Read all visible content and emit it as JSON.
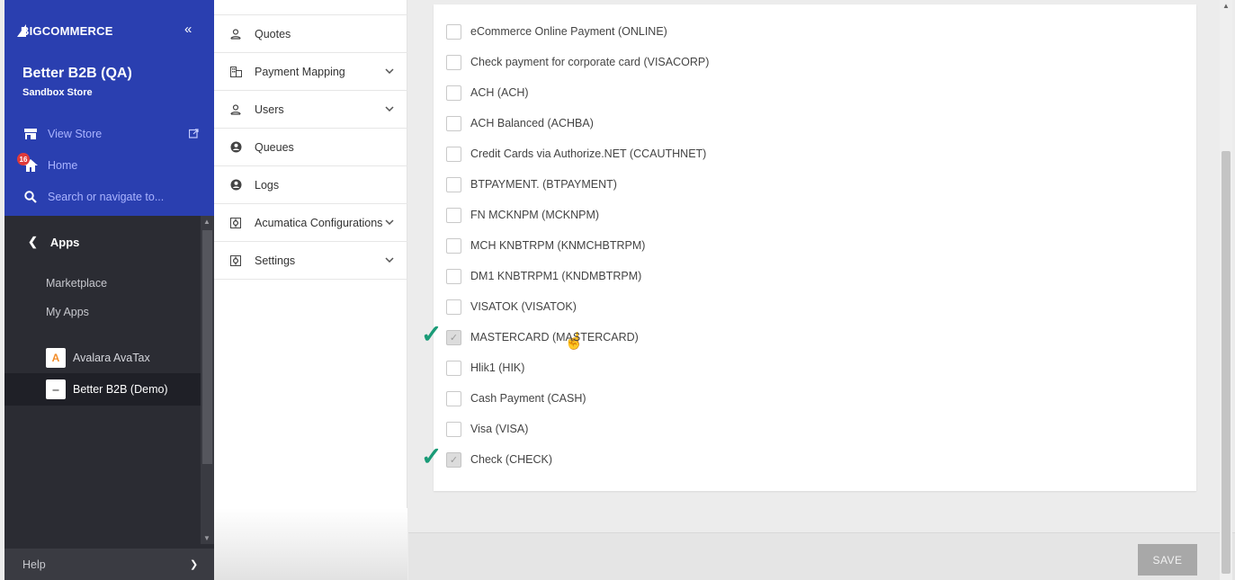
{
  "sidebar": {
    "brand": "BIGCOMMERCE",
    "collapse_icon": "«",
    "store_name": "Better B2B (QA)",
    "store_type": "Sandbox Store",
    "view_store": "View Store",
    "home": "Home",
    "home_badge": "16",
    "search_placeholder": "Search or navigate to...",
    "apps_back": "Apps",
    "marketplace": "Marketplace",
    "my_apps": "My Apps",
    "installed_apps": [
      {
        "label": "Avalara AvaTax",
        "icon": "avalara-icon"
      },
      {
        "label": "Better B2B (Demo)",
        "icon": "better-b2b-icon"
      }
    ],
    "help": "Help"
  },
  "appnav": {
    "items": [
      {
        "label": "Quotes",
        "icon": "user-icon",
        "has_caret": false
      },
      {
        "label": "Payment Mapping",
        "icon": "building-icon",
        "has_caret": true
      },
      {
        "label": "Users",
        "icon": "user-icon",
        "has_caret": true
      },
      {
        "label": "Queues",
        "icon": "account-circle-icon",
        "has_caret": false
      },
      {
        "label": "Logs",
        "icon": "account-circle-icon",
        "has_caret": false
      },
      {
        "label": "Acumatica Configurations",
        "icon": "config-icon",
        "has_caret": true
      },
      {
        "label": "Settings",
        "icon": "config-icon",
        "has_caret": true
      }
    ]
  },
  "payment_methods": [
    {
      "label": "eCommerce Online Payment (ONLINE)",
      "checked": false
    },
    {
      "label": "Check payment for corporate card (VISACORP)",
      "checked": false
    },
    {
      "label": "ACH (ACH)",
      "checked": false
    },
    {
      "label": "ACH Balanced (ACHBA)",
      "checked": false
    },
    {
      "label": "Credit Cards via Authorize.NET (CCAUTHNET)",
      "checked": false
    },
    {
      "label": "BTPAYMENT. (BTPAYMENT)",
      "checked": false
    },
    {
      "label": "FN MCKNPM (MCKNPM)",
      "checked": false
    },
    {
      "label": "MCH KNBTRPM (KNMCHBTRPM)",
      "checked": false
    },
    {
      "label": "DM1 KNBTRPM1 (KNDMBTRPM)",
      "checked": false
    },
    {
      "label": "VISATOK (VISATOK)",
      "checked": false
    },
    {
      "label": "MASTERCARD (MASTERCARD)",
      "checked": true
    },
    {
      "label": "Hlik1 (HIK)",
      "checked": false
    },
    {
      "label": "Cash Payment (CASH)",
      "checked": false
    },
    {
      "label": "Visa (VISA)",
      "checked": false
    },
    {
      "label": "Check (CHECK)",
      "checked": true
    }
  ],
  "footer": {
    "save": "SAVE"
  },
  "colors": {
    "brand_blue": "#2a3fb0",
    "sidebar_dark": "#2b2c33",
    "annotation_green": "#1a9b77"
  }
}
